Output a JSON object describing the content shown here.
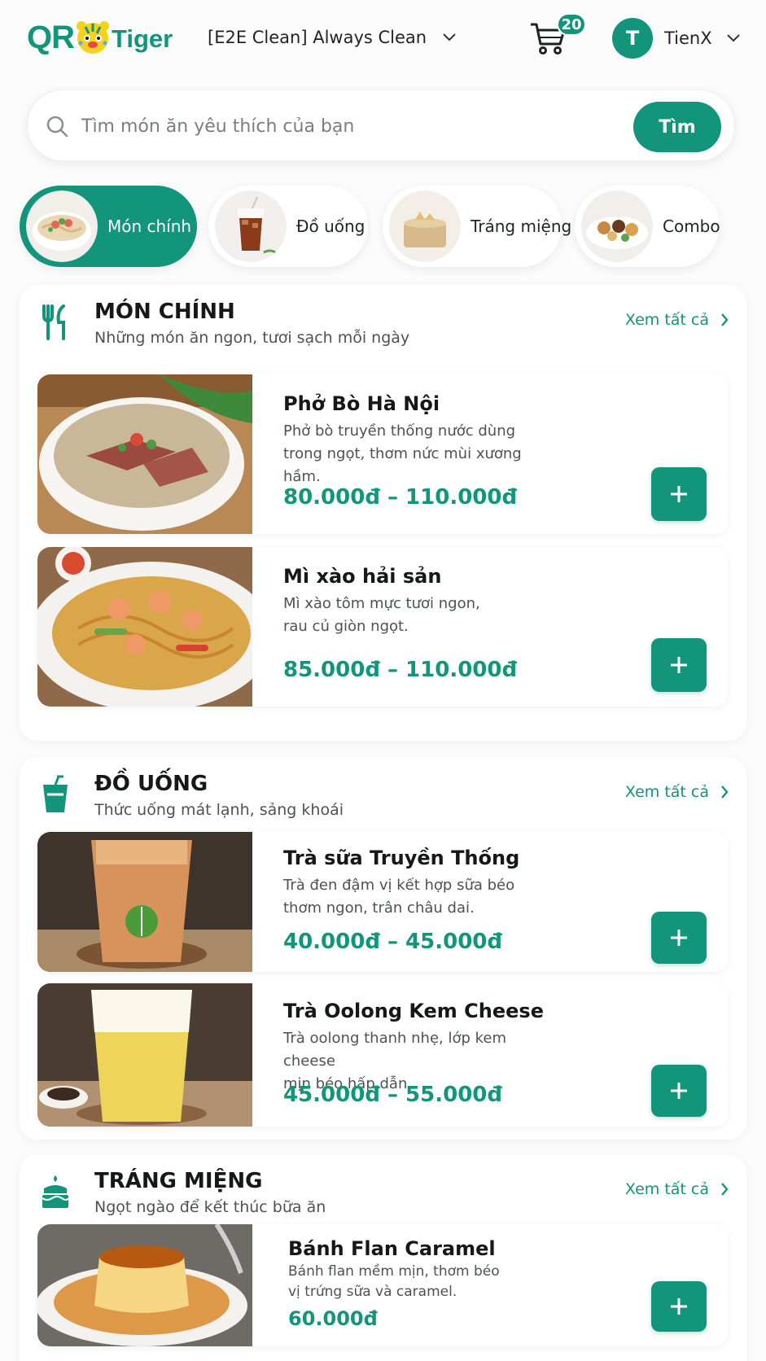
{
  "brand": {
    "qr": "QR",
    "tiger": "Tiger",
    "color": "#12957a"
  },
  "store": {
    "name": "[E2E Clean] Always Clean"
  },
  "cart": {
    "count": "20"
  },
  "user": {
    "initial": "T",
    "name": "TienX"
  },
  "search": {
    "placeholder": "Tìm món ăn yêu thích của bạn",
    "button": "Tìm"
  },
  "categories": [
    {
      "label": "Món chính",
      "active": true
    },
    {
      "label": "Đồ uống",
      "active": false
    },
    {
      "label": "Tráng miệng",
      "active": false
    },
    {
      "label": "Combo",
      "active": false
    }
  ],
  "sections": [
    {
      "title": "MÓN CHÍNH",
      "subtitle": "Những món ăn ngon, tươi sạch mỗi ngày",
      "see_all": "Xem tất cả",
      "icon": "utensils-icon",
      "items": [
        {
          "name": "Phở Bò Hà Nội",
          "desc1": "Phở bò truyền thống nước dùng",
          "desc2": "trong ngọt, thơm nức mùi xương hầm.",
          "price": "80.000đ – 110.000đ"
        },
        {
          "name": "Mì xào hải sản",
          "desc1": "Mì xào tôm mực tươi ngon,",
          "desc2": "rau củ giòn ngọt.",
          "price": "85.000đ – 110.000đ"
        }
      ]
    },
    {
      "title": "ĐỒ UỐNG",
      "subtitle": "Thức uống mát lạnh, sảng khoái",
      "see_all": "Xem tất cả",
      "icon": "drink-cup-icon",
      "items": [
        {
          "name": "Trà sữa Truyền Thống",
          "desc1": "Trà đen đậm vị kết hợp sữa béo",
          "desc2": "thơm ngon, trân châu dai.",
          "price": "40.000đ – 45.000đ"
        },
        {
          "name": "Trà Oolong Kem Cheese",
          "desc1": "Trà oolong thanh nhẹ, lớp kem cheese",
          "desc2": "mịn béo hấp dẫn.",
          "price": "45.000đ – 55.000đ"
        }
      ]
    },
    {
      "title": "TRÁNG MIỆNG",
      "subtitle": "Ngọt ngào để kết thúc bữa ăn",
      "see_all": "Xem tất cả",
      "icon": "cake-icon",
      "items": [
        {
          "name": "Bánh Flan Caramel",
          "desc1": "Bánh flan mềm mịn, thơm béo",
          "desc2": "vị trứng sữa và caramel.",
          "price": "60.000đ"
        }
      ]
    }
  ]
}
